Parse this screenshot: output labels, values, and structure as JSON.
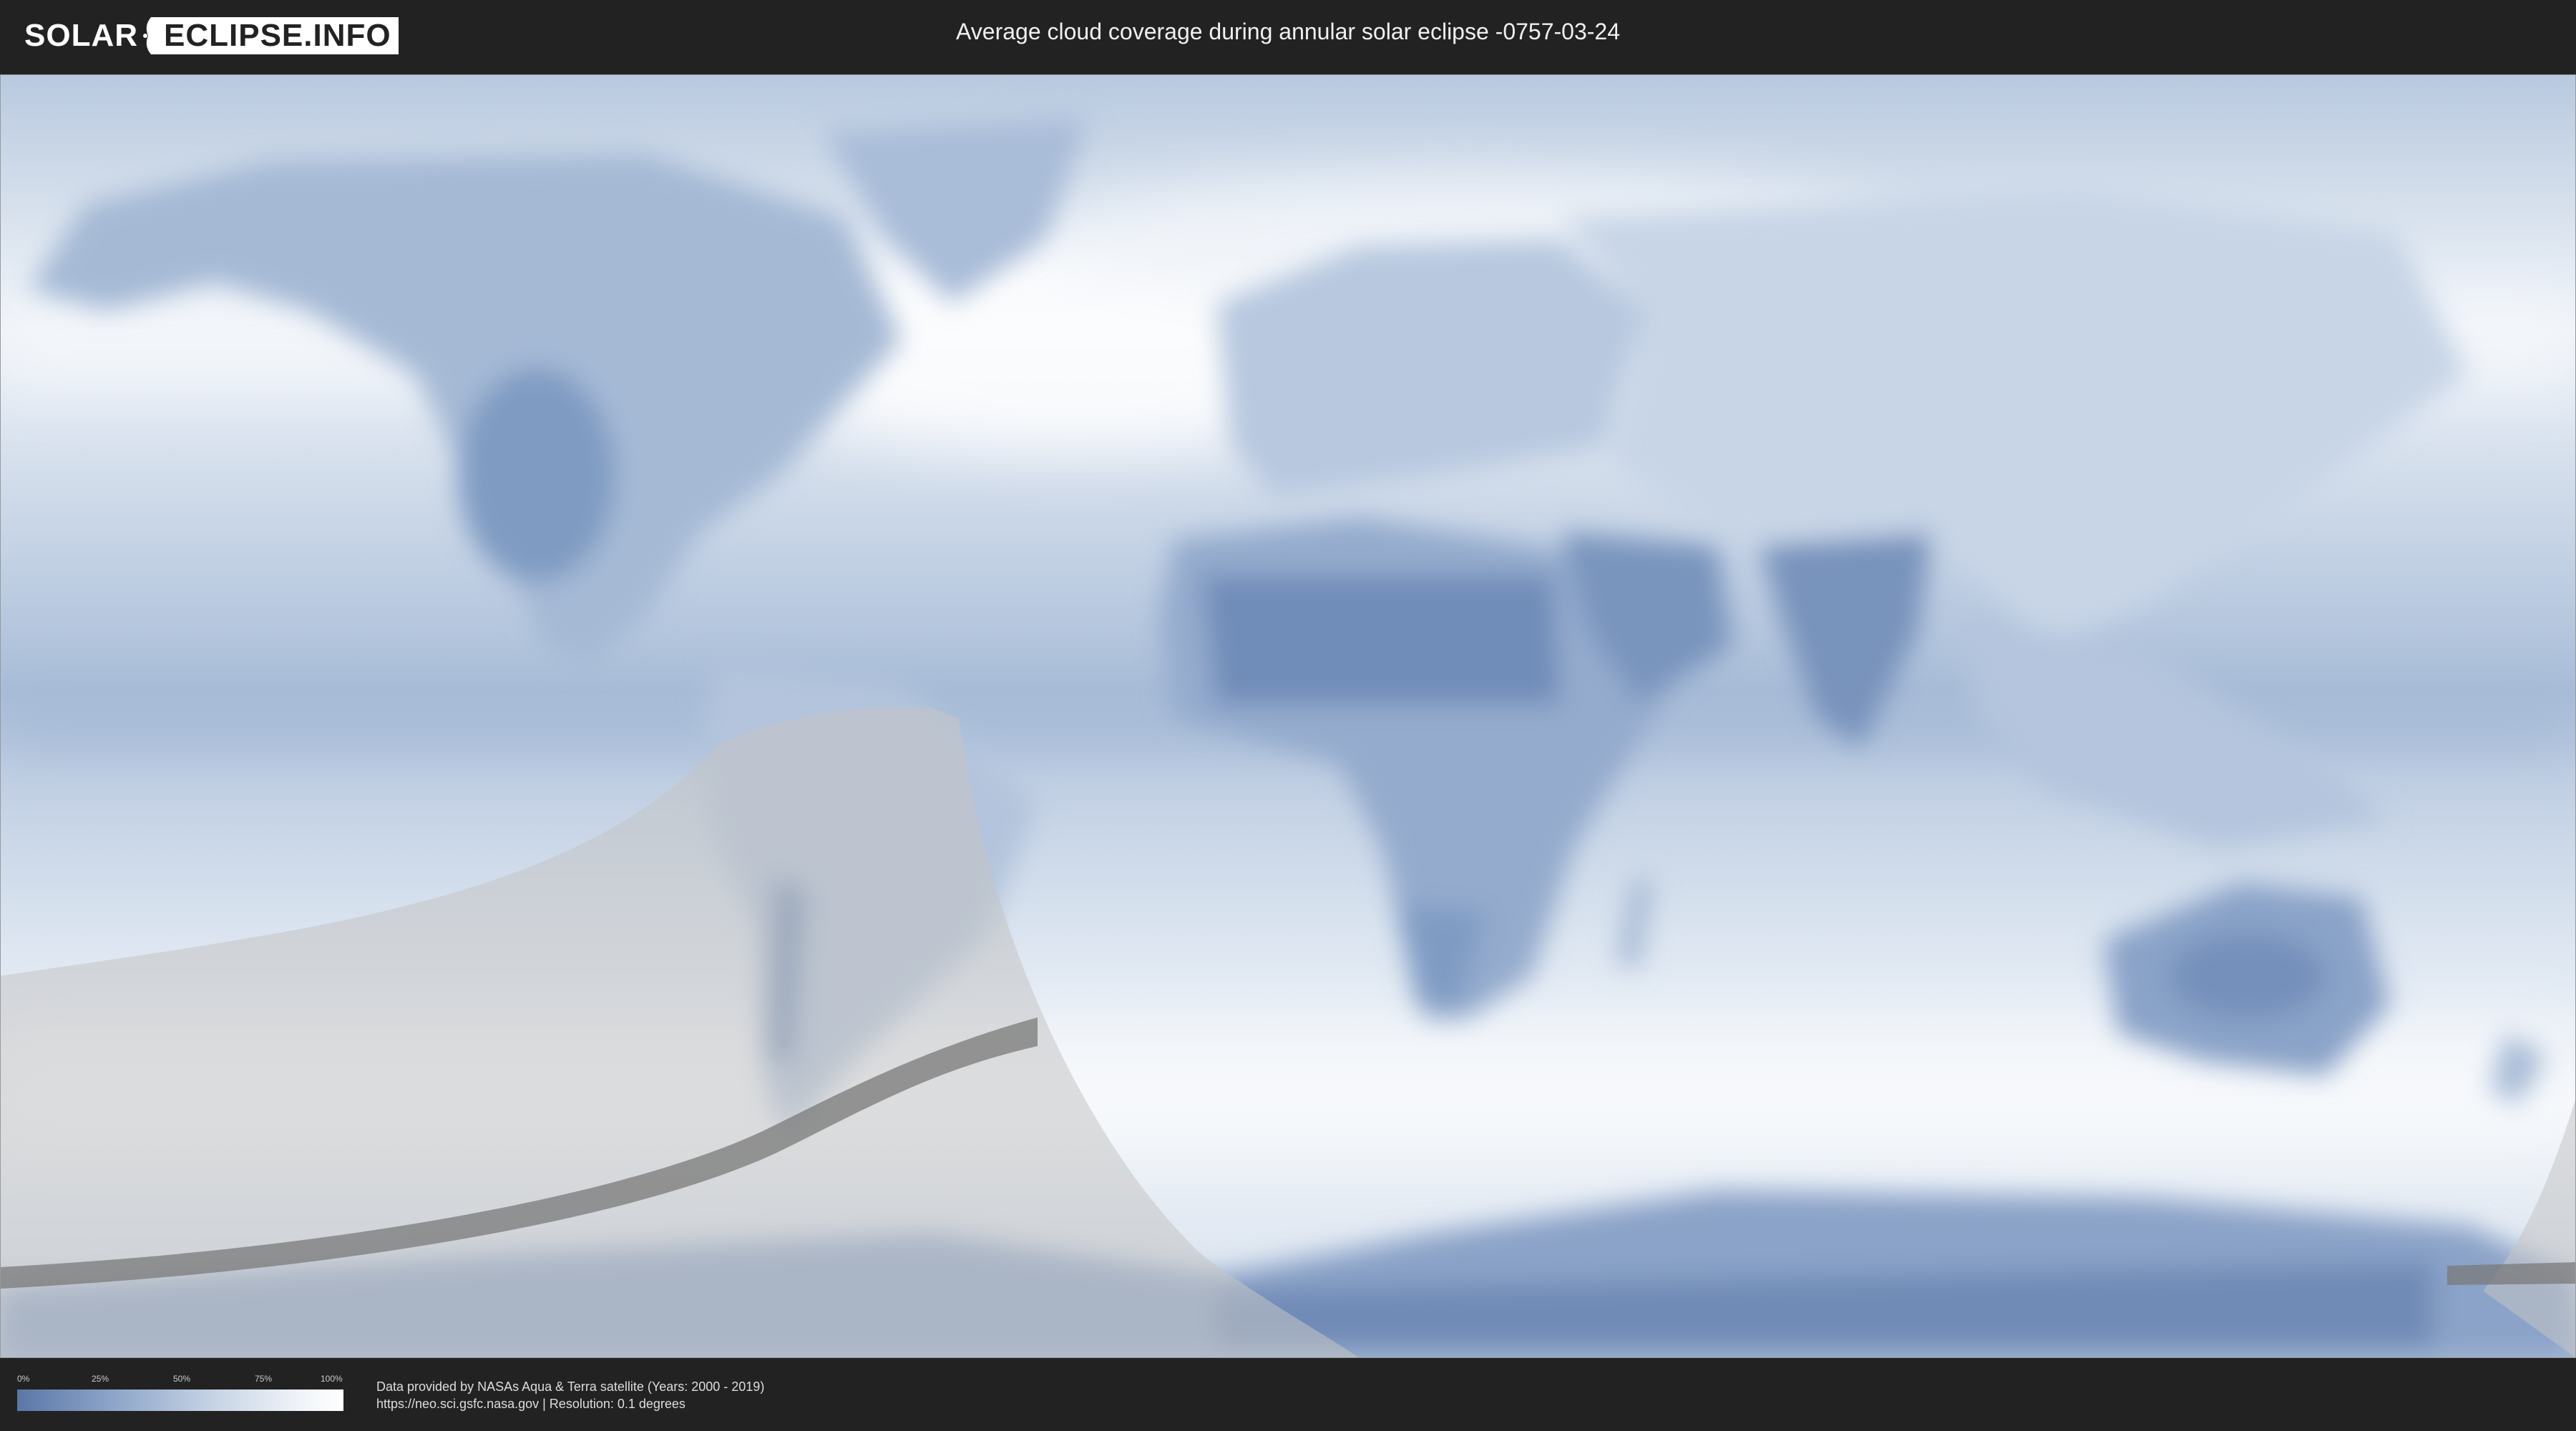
{
  "header": {
    "logo_left": "SOLAR",
    "logo_right": "ECLIPSE.INFO",
    "title": "Average cloud coverage during annular solar eclipse -0757-03-24"
  },
  "legend": {
    "ticks": [
      "0%",
      "25%",
      "50%",
      "75%",
      "100%"
    ],
    "gradient_colors": [
      "#5b77a8",
      "#8ea6c9",
      "#c6d3e5",
      "#eef2f8",
      "#ffffff"
    ]
  },
  "credits": {
    "line1": "Data provided by NASAs Aqua & Terra satellite (Years: 2000 - 2019)",
    "line2": "https://neo.sci.gsfc.nasa.gov | Resolution: 0.1 degrees"
  },
  "colors": {
    "background": "#222222",
    "ocean_cloud": "#b9c9de",
    "clear_sky": "#5b77a8",
    "eclipse_shade": "#bfbfbf",
    "annular_path": "#808080"
  }
}
